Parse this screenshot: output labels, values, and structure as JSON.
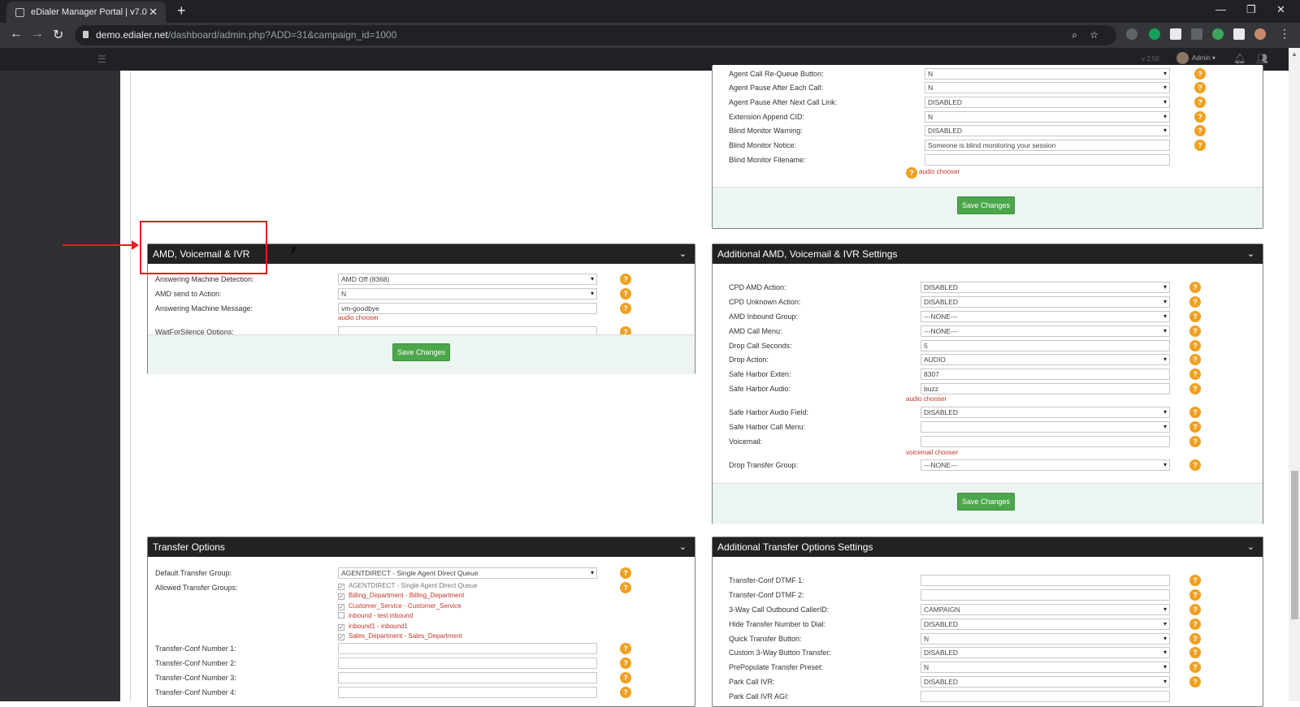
{
  "browser": {
    "tab_title": "eDialer Manager Portal | v7.0",
    "url_host": "demo.edialer.net",
    "url_path": "/dashboard/admin.php?ADD=31&campaign_id=1000"
  },
  "header": {
    "version": "v 2.50",
    "user": "Admin"
  },
  "right_top": {
    "rows": [
      {
        "label": "Agent Call Re-Queue Button:",
        "value": "N",
        "type": "select"
      },
      {
        "label": "Agent Pause After Each Call:",
        "value": "N",
        "type": "select"
      },
      {
        "label": "Agent Pause After Next Call Link:",
        "value": "DISABLED",
        "type": "select"
      },
      {
        "label": "Extension Append CID:",
        "value": "N",
        "type": "select"
      },
      {
        "label": "Blind Monitor Warning:",
        "value": "DISABLED",
        "type": "select"
      },
      {
        "label": "Blind Monitor Notice:",
        "value": "Someone is blind monitoring your session",
        "type": "text"
      },
      {
        "label": "Blind Monitor Filename:",
        "value": "",
        "type": "text"
      }
    ],
    "audio_chooser": "audio chooser",
    "save": "Save Changes"
  },
  "amd_panel": {
    "title": "AMD, Voicemail & IVR",
    "rows": [
      {
        "label": "Answering Machine Detection:",
        "value": "AMD Off (8368)",
        "type": "select"
      },
      {
        "label": "AMD send to Action:",
        "value": "N",
        "type": "select"
      },
      {
        "label": "Answering Machine Message:",
        "value": "vm-goodbye",
        "type": "text"
      },
      {
        "label": "WaitForSilence Options:",
        "value": "",
        "type": "text"
      }
    ],
    "audio_chooser": "audio chooser",
    "save": "Save Changes"
  },
  "add_amd_panel": {
    "title": "Additional AMD, Voicemail & IVR Settings",
    "rows": [
      {
        "label": "CPD AMD Action:",
        "value": "DISABLED",
        "type": "select"
      },
      {
        "label": "CPD Unknown Action:",
        "value": "DISABLED",
        "type": "select"
      },
      {
        "label": "AMD Inbound Group:",
        "value": "---NONE---",
        "type": "select"
      },
      {
        "label": "AMD Call Menu:",
        "value": "---NONE---",
        "type": "select"
      },
      {
        "label": "Drop Call Seconds:",
        "value": "5",
        "type": "text"
      },
      {
        "label": "Drop Action:",
        "value": "AUDIO",
        "type": "select"
      },
      {
        "label": "Safe Harbor Exten:",
        "value": "8307",
        "type": "text"
      },
      {
        "label": "Safe Harbor Audio:",
        "value": "buzz",
        "type": "text"
      },
      {
        "label": "Safe Harbor Audio Field:",
        "value": "DISABLED",
        "type": "select"
      },
      {
        "label": "Safe Harbor Call Menu:",
        "value": "",
        "type": "select"
      },
      {
        "label": "Voicemail:",
        "value": "",
        "type": "text"
      },
      {
        "label": "Drop Transfer Group:",
        "value": "---NONE---",
        "type": "select"
      }
    ],
    "audio_chooser": "audio chooser",
    "voicemail_chooser": "voicemail chooser",
    "save": "Save Changes"
  },
  "transfer_panel": {
    "title": "Transfer Options",
    "default_label": "Default Transfer Group:",
    "default_value": "AGENTDIRECT - Single Agent Direct Queue",
    "allowed_label": "Allowed Transfer Groups:",
    "groups": [
      {
        "name": "AGENTDIRECT - Single Agent Direct Queue",
        "checked": true
      },
      {
        "name": "Billing_Department - Billing_Department",
        "checked": true
      },
      {
        "name": "Customer_Service - Customer_Service",
        "checked": true
      },
      {
        "name": "inbound - test inbound",
        "checked": false
      },
      {
        "name": "inbound1 - inbound1",
        "checked": true
      },
      {
        "name": "Sales_Department - Sales_Department",
        "checked": true
      }
    ],
    "conf_rows": [
      {
        "label": "Transfer-Conf Number 1:"
      },
      {
        "label": "Transfer-Conf Number 2:"
      },
      {
        "label": "Transfer-Conf Number 3:"
      },
      {
        "label": "Transfer-Conf Number 4:"
      }
    ]
  },
  "add_transfer_panel": {
    "title": "Additional Transfer Options Settings",
    "rows": [
      {
        "label": "Transfer-Conf DTMF 1:",
        "value": "",
        "type": "text"
      },
      {
        "label": "Transfer-Conf DTMF 2:",
        "value": "",
        "type": "text"
      },
      {
        "label": "3-Way Call Outbound CallerID:",
        "value": "CAMPAIGN",
        "type": "select"
      },
      {
        "label": "Hide Transfer Number to Dial:",
        "value": "DISABLED",
        "type": "select"
      },
      {
        "label": "Quick Transfer Button:",
        "value": "N",
        "type": "select"
      },
      {
        "label": "Custom 3-Way Button Transfer:",
        "value": "DISABLED",
        "type": "select"
      },
      {
        "label": "PrePopulate Transfer Preset:",
        "value": "N",
        "type": "select"
      },
      {
        "label": "Park Call IVR:",
        "value": "DISABLED",
        "type": "select"
      },
      {
        "label": "Park Call IVR AGI:",
        "value": "",
        "type": "text"
      }
    ]
  },
  "colors": {
    "header_bg": "#222222",
    "save_green": "#4ca64c",
    "help_orange": "#f0a020",
    "link_red": "#c0392b",
    "annotation_red": "#e51c1c"
  }
}
